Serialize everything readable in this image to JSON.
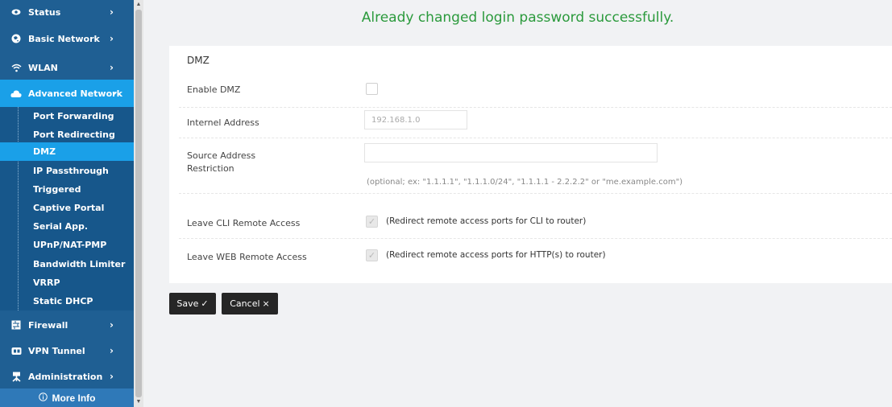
{
  "sidebar": {
    "items": [
      {
        "label": "Status",
        "icon": "eye-icon"
      },
      {
        "label": "Basic Network",
        "icon": "globe-icon"
      },
      {
        "label": "WLAN",
        "icon": "wifi-icon"
      },
      {
        "label": "Advanced Network",
        "icon": "cloud-icon"
      },
      {
        "label": "Firewall",
        "icon": "firewall-icon"
      },
      {
        "label": "VPN Tunnel",
        "icon": "vpn-icon"
      },
      {
        "label": "Administration",
        "icon": "admin-icon"
      }
    ],
    "sub_items": [
      {
        "label": "Port Forwarding"
      },
      {
        "label": "Port Redirecting"
      },
      {
        "label": "DMZ"
      },
      {
        "label": "IP Passthrough"
      },
      {
        "label": "Triggered"
      },
      {
        "label": "Captive Portal"
      },
      {
        "label": "Serial App."
      },
      {
        "label": "UPnP/NAT-PMP"
      },
      {
        "label": "Bandwidth Limiter"
      },
      {
        "label": "VRRP"
      },
      {
        "label": "Static DHCP"
      }
    ],
    "more_info": "More Info",
    "active_item": "Advanced Network",
    "active_sub_item": "DMZ",
    "colors": {
      "background": "#1f5f93",
      "active": "#1aa0e8"
    }
  },
  "notice": "Already changed login password successfully.",
  "notice_color": "#2b9a3c",
  "card": {
    "title": "DMZ",
    "enable_dmz": {
      "label": "Enable DMZ",
      "checked": false
    },
    "internal_address": {
      "label": "Internel Address",
      "placeholder": "192.168.1.0",
      "value": ""
    },
    "source_restriction": {
      "label_line1": "Source Address",
      "label_line2": "Restriction",
      "value": "",
      "hint": "(optional; ex: \"1.1.1.1\", \"1.1.1.0/24\", \"1.1.1.1 - 2.2.2.2\" or \"me.example.com\")"
    },
    "cli_remote": {
      "label": "Leave CLI Remote Access",
      "checked": true,
      "description": "(Redirect remote access ports for CLI to router)"
    },
    "web_remote": {
      "label": "Leave WEB Remote Access",
      "checked": true,
      "description": "(Redirect remote access ports for HTTP(s) to router)"
    }
  },
  "buttons": {
    "save": "Save",
    "cancel": "Cancel"
  }
}
